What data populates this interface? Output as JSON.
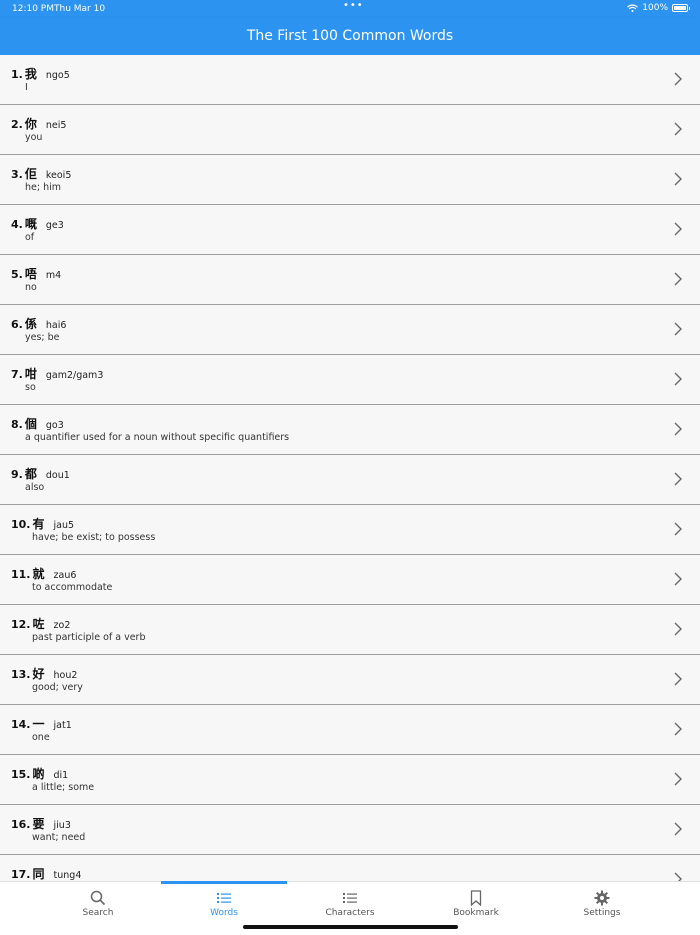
{
  "status": {
    "time": "12:10 PM",
    "date": "Thu Mar 10",
    "dots": "•••",
    "battery": "100%"
  },
  "app_bar": {
    "title": "The First 100 Common Words"
  },
  "words": [
    {
      "num": "1.",
      "char": "我",
      "jyutping": "ngo5",
      "meaning": "I"
    },
    {
      "num": "2.",
      "char": "你",
      "jyutping": "nei5",
      "meaning": "you"
    },
    {
      "num": "3.",
      "char": "佢",
      "jyutping": "keoi5",
      "meaning": "he; him"
    },
    {
      "num": "4.",
      "char": "嘅",
      "jyutping": "ge3",
      "meaning": "of"
    },
    {
      "num": "5.",
      "char": "唔",
      "jyutping": "m4",
      "meaning": "no"
    },
    {
      "num": "6.",
      "char": "係",
      "jyutping": "hai6",
      "meaning": "yes; be"
    },
    {
      "num": "7.",
      "char": "咁",
      "jyutping": "gam2/gam3",
      "meaning": "so"
    },
    {
      "num": "8.",
      "char": "個",
      "jyutping": "go3",
      "meaning": "a quantifier used for a noun without specific quantifiers"
    },
    {
      "num": "9.",
      "char": "都",
      "jyutping": "dou1",
      "meaning": "also"
    },
    {
      "num": "10.",
      "char": "有",
      "jyutping": "jau5",
      "meaning": "have; be exist; to possess"
    },
    {
      "num": "11.",
      "char": "就",
      "jyutping": "zau6",
      "meaning": "to accommodate"
    },
    {
      "num": "12.",
      "char": "咗",
      "jyutping": "zo2",
      "meaning": "past participle of a verb"
    },
    {
      "num": "13.",
      "char": "好",
      "jyutping": "hou2",
      "meaning": "good; very"
    },
    {
      "num": "14.",
      "char": "一",
      "jyutping": "jat1",
      "meaning": "one"
    },
    {
      "num": "15.",
      "char": "啲",
      "jyutping": "di1",
      "meaning": "a little; some"
    },
    {
      "num": "16.",
      "char": "要",
      "jyutping": "jiu3",
      "meaning": "want; need"
    },
    {
      "num": "17.",
      "char": "同",
      "jyutping": "tung4",
      "meaning": ""
    }
  ],
  "nav": [
    {
      "label": "Search",
      "icon": "search-icon"
    },
    {
      "label": "Words",
      "icon": "list-icon"
    },
    {
      "label": "Characters",
      "icon": "list-icon"
    },
    {
      "label": "Bookmark",
      "icon": "bookmark-icon"
    },
    {
      "label": "Settings",
      "icon": "gear-icon"
    }
  ],
  "colors": {
    "accent": "#2c93f0"
  }
}
